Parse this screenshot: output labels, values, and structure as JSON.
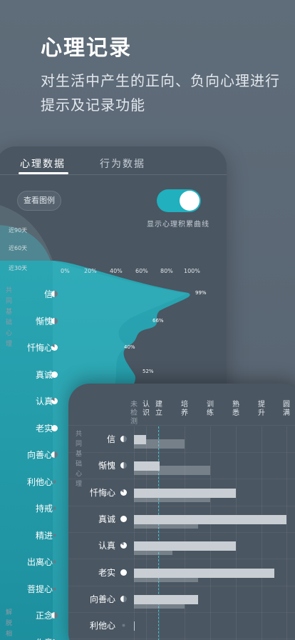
{
  "hero": {
    "title": "心理记录",
    "subtitle": "对生活中产生的正向、负向心理进行提示及记录功能"
  },
  "back_screen": {
    "tabs": [
      {
        "label": "心理数据",
        "active": true
      },
      {
        "label": "行为数据",
        "active": false
      }
    ],
    "legend_button": "查看图例",
    "toggle": {
      "on": true,
      "caption": "显示心理积累曲线"
    },
    "period_labels": [
      "近90天",
      "近60天",
      "近30天"
    ],
    "percent_ticks": [
      "0%",
      "20%",
      "40%",
      "60%",
      "80%",
      "100%"
    ],
    "category_side": "共同基础心理",
    "category_side_2": "解脱相",
    "rows": [
      {
        "label": "信",
        "dot": "half"
      },
      {
        "label": "惭愧",
        "dot": "half"
      },
      {
        "label": "忏悔心",
        "dot": "mostly"
      },
      {
        "label": "真诚",
        "dot": "full"
      },
      {
        "label": "认真",
        "dot": "mostly"
      },
      {
        "label": "老实",
        "dot": "full"
      },
      {
        "label": "向善心",
        "dot": "half"
      },
      {
        "label": "利他心",
        "dot": "empty"
      },
      {
        "label": "持戒",
        "dot": "empty"
      },
      {
        "label": "精进",
        "dot": "empty"
      },
      {
        "label": "出离心",
        "dot": "empty"
      },
      {
        "label": "菩提心",
        "dot": "empty"
      },
      {
        "label": "正念",
        "dot": "half"
      },
      {
        "label": "作意",
        "dot": "half"
      }
    ],
    "peaks": [
      "99%",
      "66%",
      "40%",
      "52%"
    ]
  },
  "front_screen": {
    "columns": [
      {
        "label": "未检测",
        "dim": true
      },
      {
        "label": "认识",
        "dim": false
      },
      {
        "label": "建立",
        "dim": false
      },
      {
        "label": "培养",
        "dim": false
      },
      {
        "label": "训练",
        "dim": false
      },
      {
        "label": "熟悉",
        "dim": false
      },
      {
        "label": "提升",
        "dim": false
      },
      {
        "label": "圆满",
        "dim": false
      }
    ],
    "category_side": "共同基础心理",
    "rows": [
      {
        "label": "信",
        "dot": "half",
        "level": 0.08,
        "prev": 0.33
      },
      {
        "label": "惭愧",
        "dot": "half",
        "level": 0.17,
        "prev": 0.5
      },
      {
        "label": "忏悔心",
        "dot": "mostly",
        "level": 0.67,
        "prev": 0.5
      },
      {
        "label": "真诚",
        "dot": "full",
        "level": 1.0,
        "prev": 0.42
      },
      {
        "label": "认真",
        "dot": "mostly",
        "level": 0.67,
        "prev": 0.25
      },
      {
        "label": "老实",
        "dot": "full",
        "level": 0.92,
        "prev": 0.42
      },
      {
        "label": "向善心",
        "dot": "half",
        "level": 0.42,
        "prev": 0.33
      },
      {
        "label": "利他心",
        "dot": "empty",
        "level": 0.0,
        "prev": 0.0
      }
    ],
    "colors": {
      "accent": "#20b0be",
      "bar": "#c8ced3"
    }
  }
}
